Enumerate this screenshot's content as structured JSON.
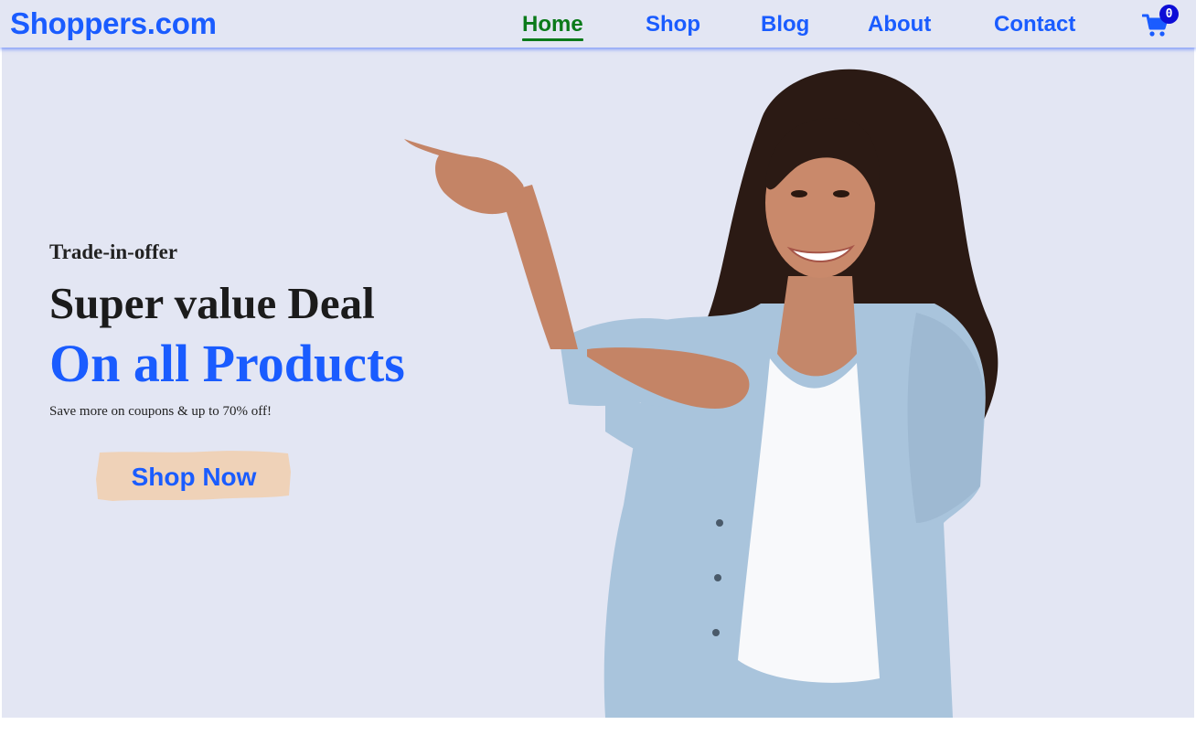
{
  "brand": {
    "name": "Shoppers.com",
    "color": "#1a5cff"
  },
  "nav": {
    "items": [
      {
        "label": "Home",
        "active": true
      },
      {
        "label": "Shop",
        "active": false
      },
      {
        "label": "Blog",
        "active": false
      },
      {
        "label": "About",
        "active": false
      },
      {
        "label": "Contact",
        "active": false
      }
    ],
    "active_color": "#0b7a1a",
    "link_color": "#1a5cff",
    "cart": {
      "icon": "shopping-cart-icon",
      "count": "0"
    }
  },
  "hero": {
    "offer_label": "Trade-in-offer",
    "headline": "Super value Deal",
    "subheadline": "On all Products",
    "tagline": "Save more on coupons & up to 70% off!",
    "cta_label": "Shop Now",
    "background_color": "#e3e6f3",
    "cta_background": "#efd2b8",
    "image": "woman-pointing-left-photo"
  }
}
